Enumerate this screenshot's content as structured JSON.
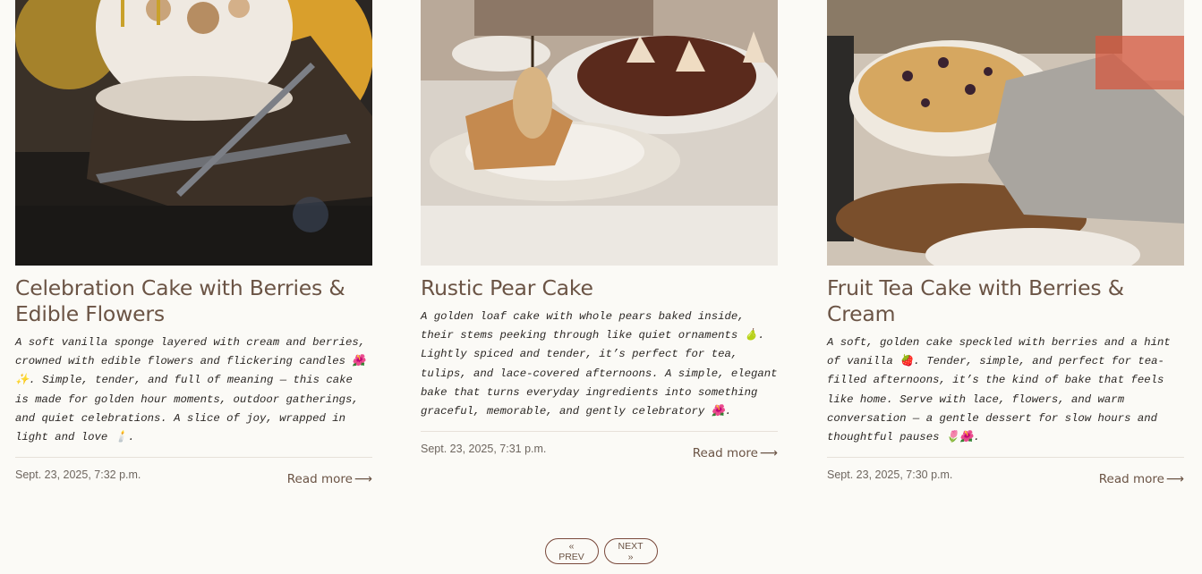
{
  "posts": [
    {
      "title": "Celebration Cake with Berries & Edible Flowers",
      "excerpt": "A soft vanilla sponge layered with cream and berries, crowned with edible flowers and flickering candles 🌺✨. Simple, tender, and full of meaning — this cake is made for golden hour moments, outdoor gatherings, and quiet celebrations. A slice of joy, wrapped in light and love 🕯️.",
      "date": "Sept. 23, 2025, 7:32 p.m.",
      "read_more": "Read more",
      "image_icon": "celebration-cake-photo"
    },
    {
      "title": "Rustic Pear Cake",
      "excerpt": "A golden loaf cake with whole pears baked inside, their stems peeking through like quiet ornaments 🍐. Lightly spiced and tender, it’s perfect for tea, tulips, and lace-covered afternoons. A simple, elegant bake that turns everyday ingredients into something graceful, memorable, and gently celebratory 🌺.",
      "date": "Sept. 23, 2025, 7:31 p.m.",
      "read_more": "Read more",
      "image_icon": "pear-cake-photo"
    },
    {
      "title": "Fruit Tea Cake with Berries & Cream",
      "excerpt": "A soft, golden cake speckled with berries and a hint of vanilla 🍓. Tender, simple, and perfect for tea-filled afternoons, it’s the kind of bake that feels like home. Serve with lace, flowers, and warm conversation — a gentle dessert for slow hours and thoughtful pauses 🌷🌺.",
      "date": "Sept. 23, 2025, 7:30 p.m.",
      "read_more": "Read more",
      "image_icon": "fruit-tea-cake-photo"
    }
  ],
  "pagination": {
    "prev_label": "« PREV",
    "next_label": "NEXT »"
  },
  "colors": {
    "background": "#fbfaf6",
    "title": "#6b5445",
    "accent_border": "#7a4a3c"
  }
}
